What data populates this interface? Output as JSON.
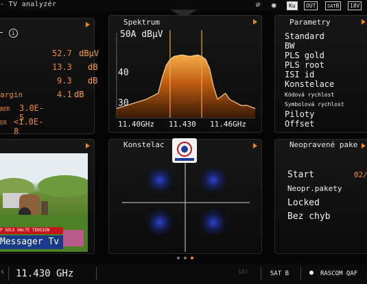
{
  "app": {
    "title": "- TV analyzér"
  },
  "status": {
    "ku": "Ku",
    "out": "OUT",
    "sat": "SAT",
    "sat_slot": "B",
    "voltage": "18V"
  },
  "measure": {
    "rows": [
      {
        "label": "",
        "value": "52.7",
        "unit": "dBµV"
      },
      {
        "label": "",
        "value": "13.3",
        "unit": "dB"
      },
      {
        "label": "",
        "value": "9.3",
        "unit": "dB"
      },
      {
        "label": "argin",
        "value": "4.1",
        "unit": "dB"
      },
      {
        "label": "BER",
        "value": "3.0E-5",
        "unit": ""
      },
      {
        "label": "ER",
        "value": "<1.0E-8",
        "unit": ""
      }
    ]
  },
  "spectrum": {
    "title": "Spektrum"
  },
  "chart_data": {
    "type": "line",
    "title": "",
    "ylabel": "50A dBµV",
    "ylim": [
      25,
      50
    ],
    "yticks": [
      30,
      40
    ],
    "xticks": [
      "11.40GHz",
      "11.430",
      "11.46GHz"
    ],
    "xlim": [
      11.395,
      11.465
    ],
    "markers": [
      11.422,
      11.438
    ],
    "series": [
      {
        "x": [
          11.395,
          11.4,
          11.405,
          11.41,
          11.413,
          11.416,
          11.418,
          11.42,
          11.422,
          11.424,
          11.428,
          11.432,
          11.436,
          11.438,
          11.44,
          11.442,
          11.444,
          11.446,
          11.448,
          11.45,
          11.452,
          11.455,
          11.458,
          11.461,
          11.465
        ],
        "values": [
          28,
          29,
          30,
          31,
          32,
          33,
          38,
          42,
          44,
          45,
          45.5,
          45,
          45.5,
          45,
          44,
          41,
          35,
          31,
          32,
          33,
          31,
          30,
          29,
          29,
          28
        ]
      }
    ]
  },
  "params": {
    "title": "Parametry",
    "items": [
      "Standard",
      "BW",
      "PLS gold",
      "PLS root",
      "ISI id",
      "Konstelace",
      "Kódová rychlost",
      "Symbolová rychlost",
      "Piloty",
      "Offset"
    ]
  },
  "video": {
    "ticker": "P SOLS HALTE TENSION",
    "channel": "Messager Tv"
  },
  "constellation": {
    "title": "Konstelac"
  },
  "errors": {
    "title": "Neopravené pake",
    "start_label": "Start",
    "start_value": "02/",
    "packets_label": "Neopr.pakety",
    "state1": "Locked",
    "state2": "Bez chyb"
  },
  "bottom": {
    "frequency": "11.430 GHz",
    "sat_label": "SAT B",
    "satellite": "RASCOM QAF"
  },
  "colors": {
    "accent": "#f08a2a",
    "marker": "#f2a84a"
  }
}
